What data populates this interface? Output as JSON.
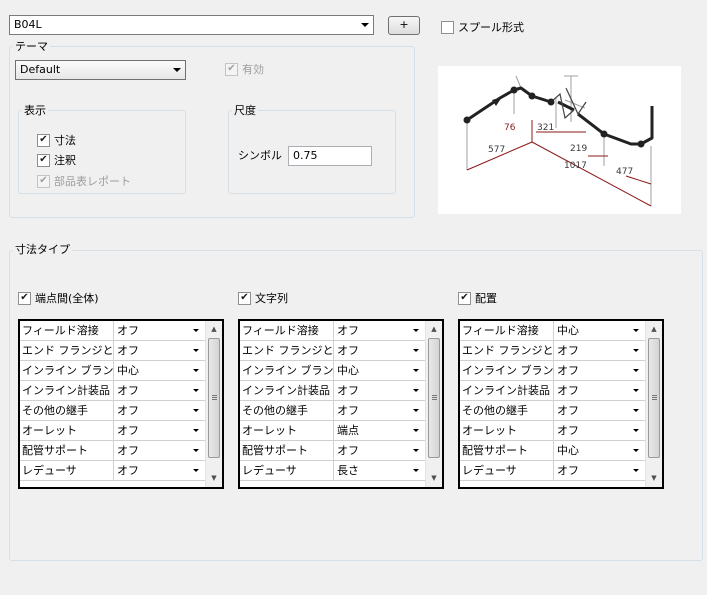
{
  "top": {
    "selected_value": "B04L",
    "add_button_label": "+",
    "spool_format_label": "スプール形式",
    "spool_format_checked": false
  },
  "theme": {
    "group_label": "テーマ",
    "selected_value": "Default",
    "enabled_label": "有効",
    "enabled_checked": true,
    "display": {
      "group_label": "表示",
      "items": [
        {
          "label": "寸法",
          "checked": true,
          "disabled": false
        },
        {
          "label": "注釈",
          "checked": true,
          "disabled": false
        },
        {
          "label": "部品表レポート",
          "checked": true,
          "disabled": true
        }
      ]
    },
    "scale": {
      "group_label": "尺度",
      "symbol_label": "シンボル",
      "symbol_value": "0.75"
    }
  },
  "preview": {
    "dimension_labels": [
      "76",
      "577",
      "321",
      "219",
      "1017",
      "477"
    ],
    "colors": {
      "pipe": "#222222",
      "dimension": "#8b1a1a",
      "leader": "#a0a0a0"
    }
  },
  "dimension_types": {
    "group_label": "寸法タイプ",
    "panels": [
      {
        "label": "端点間(全体)",
        "checked": true,
        "rows": [
          {
            "name": "フィールド溶接",
            "value": "オフ"
          },
          {
            "name": "エンド フランジと…",
            "value": "オフ"
          },
          {
            "name": "インライン ブランチ",
            "value": "中心"
          },
          {
            "name": "インライン計装品",
            "value": "オフ"
          },
          {
            "name": "その他の継手",
            "value": "オフ"
          },
          {
            "name": "オーレット",
            "value": "オフ"
          },
          {
            "name": "配管サポート",
            "value": "オフ"
          },
          {
            "name": "レデューサ",
            "value": "オフ"
          }
        ]
      },
      {
        "label": "文字列",
        "checked": true,
        "rows": [
          {
            "name": "フィールド溶接",
            "value": "オフ"
          },
          {
            "name": "エンド フランジと…",
            "value": "オフ"
          },
          {
            "name": "インライン ブランチ",
            "value": "中心"
          },
          {
            "name": "インライン計装品",
            "value": "オフ"
          },
          {
            "name": "その他の継手",
            "value": "オフ"
          },
          {
            "name": "オーレット",
            "value": "端点"
          },
          {
            "name": "配管サポート",
            "value": "オフ"
          },
          {
            "name": "レデューサ",
            "value": "長さ"
          }
        ]
      },
      {
        "label": "配置",
        "checked": true,
        "rows": [
          {
            "name": "フィールド溶接",
            "value": "中心"
          },
          {
            "name": "エンド フランジと…",
            "value": "オフ"
          },
          {
            "name": "インライン ブランチ",
            "value": "オフ"
          },
          {
            "name": "インライン計装品",
            "value": "オフ"
          },
          {
            "name": "その他の継手",
            "value": "オフ"
          },
          {
            "name": "オーレット",
            "value": "オフ"
          },
          {
            "name": "配管サポート",
            "value": "中心"
          },
          {
            "name": "レデューサ",
            "value": "オフ"
          }
        ]
      }
    ]
  }
}
